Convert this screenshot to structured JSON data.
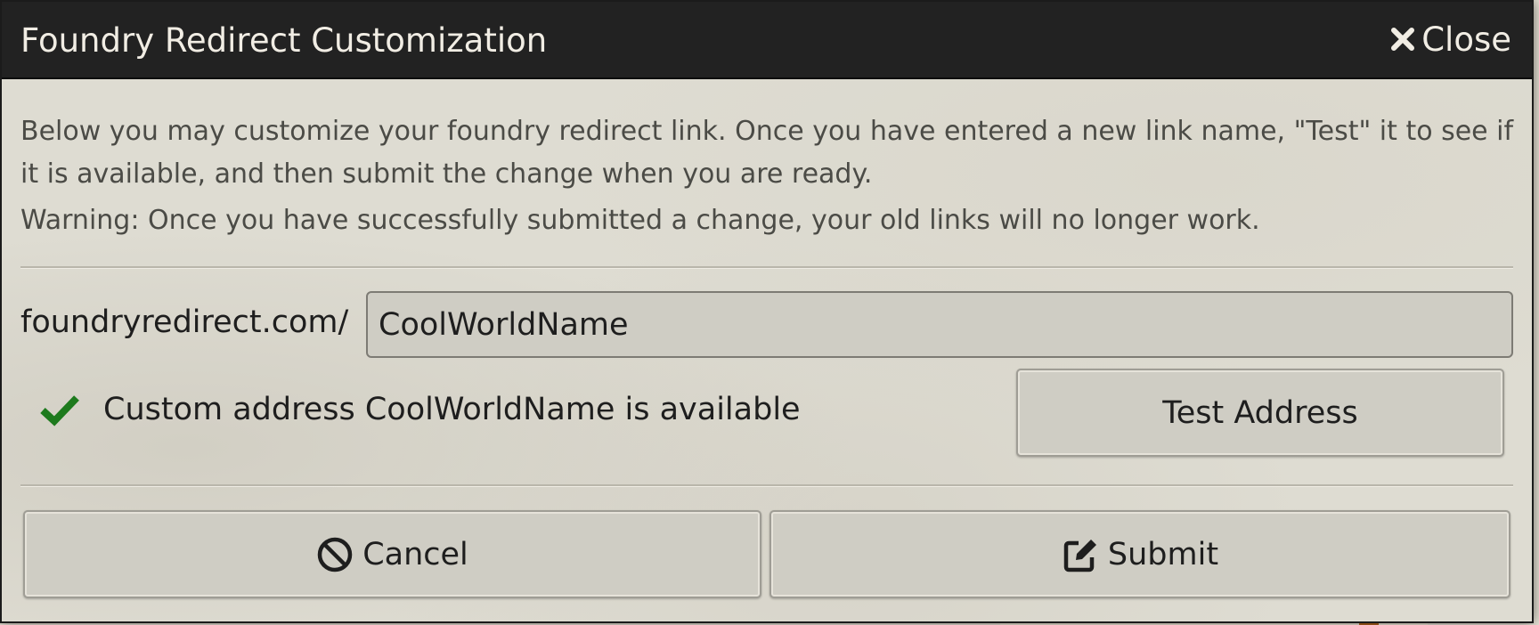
{
  "dialog": {
    "title": "Foundry Redirect Customization",
    "close_label": "Close"
  },
  "intro": {
    "text": "Below you may customize your foundry redirect link. Once you have entered a new link name, \"Test\" it to see if it is available, and then submit the change when you are ready.",
    "warning": "Warning: Once you have successfully submitted a change, your old links will no longer work."
  },
  "address": {
    "prefix": "foundryredirect.com/",
    "value": "CoolWorldName"
  },
  "status": {
    "text": "Custom address CoolWorldName is available",
    "state": "available",
    "icon": "checkmark-icon",
    "color": "#1d7a1d"
  },
  "buttons": {
    "test_label": "Test Address",
    "cancel_label": "Cancel",
    "submit_label": "Submit"
  },
  "colors": {
    "titlebar_bg": "#222222",
    "dialog_bg": "#dedcd2",
    "text": "#1e1e1e",
    "muted_text": "#4b4b46"
  }
}
